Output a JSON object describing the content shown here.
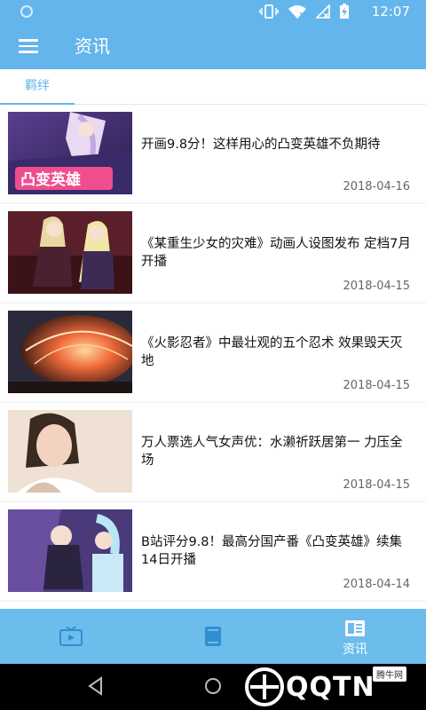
{
  "status_bar": {
    "time": "12:07"
  },
  "app_bar": {
    "title": "资讯"
  },
  "tabs": [
    {
      "label": "羁绊"
    }
  ],
  "news": [
    {
      "title": "开画9.8分！这样用心的凸变英雄不负期待",
      "date": "2018-04-16",
      "thumb_text": "凸变英雄"
    },
    {
      "title": "《某重生少女的灾难》动画人设图发布 定档7月开播",
      "date": "2018-04-15"
    },
    {
      "title": "《火影忍者》中最壮观的五个忍术 效果毁天灭地",
      "date": "2018-04-15"
    },
    {
      "title": "万人票选人气女声优：水濑祈跃居第一 力压全场",
      "date": "2018-04-15"
    },
    {
      "title": "B站评分9.8！最高分国产番《凸变英雄》续集14日开播",
      "date": "2018-04-14"
    }
  ],
  "bottom_nav": [
    {
      "icon": "tv-icon",
      "label": ""
    },
    {
      "icon": "book-icon",
      "label": ""
    },
    {
      "icon": "news-icon",
      "label": "资讯"
    }
  ],
  "watermark": {
    "text": "QQTN",
    "badge": "腾牛网"
  },
  "colors": {
    "primary": "#64b5ec",
    "nav": "#6cbcec"
  }
}
